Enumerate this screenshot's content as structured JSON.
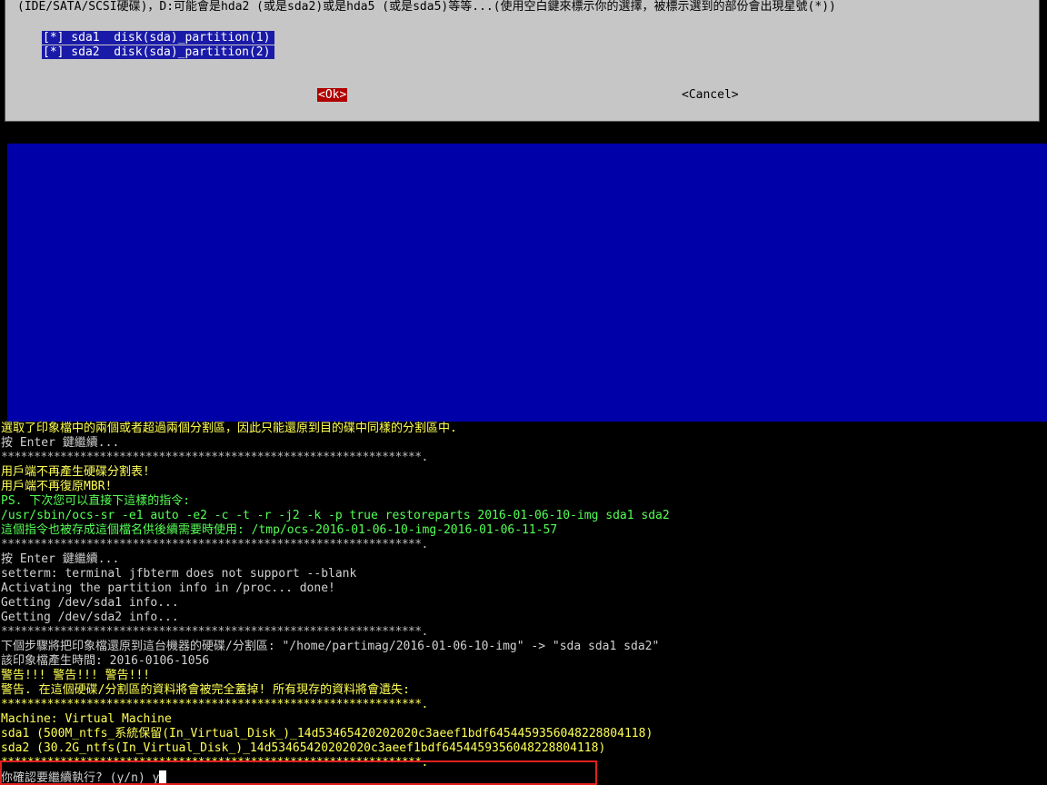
{
  "dialog": {
    "description": "(IDE/SATA/SCSI硬碟)，D:可能會是hda2 (或是sda2)或是hda5 (或是sda5)等等...(使用空白鍵來標示你的選擇，被標示選到的部份會出現星號(*))",
    "partitions": [
      {
        "label": "[*] sda1  disk(sda)_partition(1)"
      },
      {
        "label": "[*] sda2  disk(sda)_partition(2)"
      }
    ],
    "ok_label": "<Ok>",
    "cancel_label": "<Cancel>"
  },
  "terminal": {
    "lines": [
      {
        "text": "選取了印象檔中的兩個或者超過兩個分割區，因此只能還原到目的碟中同樣的分割區中.",
        "color": "yellow"
      },
      {
        "text": "按 Enter 鍵繼續...",
        "color": "white"
      },
      {
        "text": "****************************************************************.",
        "color": "whitestar"
      },
      {
        "text": "用戶端不再產生硬碟分割表!",
        "color": "yellow"
      },
      {
        "text": "用戶端不再復原MBR!",
        "color": "yellow"
      },
      {
        "text": "PS. 下次您可以直接下這樣的指令:",
        "color": "green"
      },
      {
        "text": "/usr/sbin/ocs-sr -e1 auto -e2 -c -t -r -j2 -k -p true restoreparts 2016-01-06-10-img sda1 sda2",
        "color": "green"
      },
      {
        "text": "這個指令也被存成這個檔名供後續需要時使用: /tmp/ocs-2016-01-06-10-img-2016-01-06-11-57",
        "color": "green"
      },
      {
        "text": "****************************************************************.",
        "color": "whitestar"
      },
      {
        "text": "按 Enter 鍵繼續...",
        "color": "white"
      },
      {
        "text": "setterm: terminal jfbterm does not support --blank",
        "color": "white"
      },
      {
        "text": "Activating the partition info in /proc... done!",
        "color": "white"
      },
      {
        "text": "Getting /dev/sda1 info...",
        "color": "white"
      },
      {
        "text": "Getting /dev/sda2 info...",
        "color": "white"
      },
      {
        "text": "****************************************************************.",
        "color": "whitestar"
      },
      {
        "text": "下個步驟將把印象檔還原到這台機器的硬碟/分割區: \"/home/partimag/2016-01-06-10-img\" -> \"sda sda1 sda2\"",
        "color": "white"
      },
      {
        "text": "該印象檔產生時間: 2016-0106-1056",
        "color": "white"
      },
      {
        "text": "警告!!! 警告!!! 警告!!!",
        "color": "yellow"
      },
      {
        "text": "警告. 在這個硬碟/分割區的資料將會被完全蓋掉! 所有現存的資料將會遺失:",
        "color": "yellow"
      },
      {
        "text": "****************************************************************.",
        "color": "yellowstar"
      },
      {
        "text": "Machine: Virtual Machine",
        "color": "yellow"
      },
      {
        "text": "sda1 (500M_ntfs_系統保留(In_Virtual_Disk_)_14d53465420202020c3aeef1bdf6454459356048228804118)",
        "color": "yellow"
      },
      {
        "text": "sda2 (30.2G_ntfs(In_Virtual_Disk_)_14d53465420202020c3aeef1bdf6454459356048228804118)",
        "color": "yellow"
      },
      {
        "text": "****************************************************************.",
        "color": "yellowstar"
      }
    ],
    "prompt_text": "你確認要繼續執行? (y/n) ",
    "prompt_input": "y"
  }
}
